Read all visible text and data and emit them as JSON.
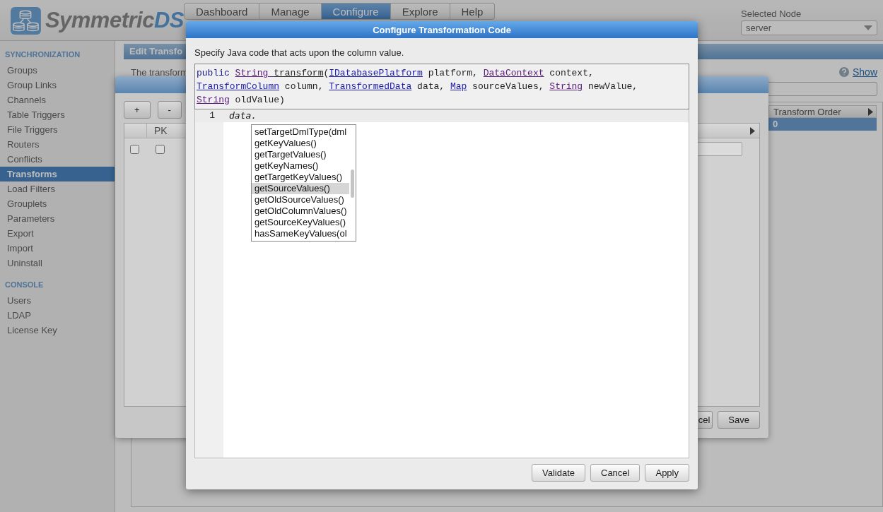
{
  "logo": {
    "name": "Symmetric",
    "suffix": "DS"
  },
  "nav_tabs": [
    {
      "label": "Dashboard",
      "selected": false
    },
    {
      "label": "Manage",
      "selected": false
    },
    {
      "label": "Configure",
      "selected": true
    },
    {
      "label": "Explore",
      "selected": false
    },
    {
      "label": "Help",
      "selected": false
    }
  ],
  "node_selector": {
    "label": "Selected Node",
    "value": "server"
  },
  "sidebar": {
    "sections": [
      {
        "heading": "SYNCHRONIZATION",
        "items": [
          {
            "label": "Groups",
            "selected": false
          },
          {
            "label": "Group Links",
            "selected": false
          },
          {
            "label": "Channels",
            "selected": false
          },
          {
            "label": "Table Triggers",
            "selected": false
          },
          {
            "label": "File Triggers",
            "selected": false
          },
          {
            "label": "Routers",
            "selected": false
          },
          {
            "label": "Conflicts",
            "selected": false
          },
          {
            "label": "Transforms",
            "selected": true
          },
          {
            "label": "Load Filters",
            "selected": false
          },
          {
            "label": "Grouplets",
            "selected": false
          },
          {
            "label": "Parameters",
            "selected": false
          },
          {
            "label": "Export",
            "selected": false
          },
          {
            "label": "Import",
            "selected": false
          },
          {
            "label": "Uninstall",
            "selected": false
          }
        ]
      },
      {
        "heading": "CONSOLE",
        "items": [
          {
            "label": "Users",
            "selected": false
          },
          {
            "label": "LDAP",
            "selected": false
          },
          {
            "label": "License Key",
            "selected": false
          }
        ]
      }
    ]
  },
  "panel": {
    "title": "Edit Transfo",
    "description": "The transform",
    "help_link": "Show",
    "table": {
      "columns": [
        "Transform Order"
      ],
      "rows": [
        {
          "cells": [
            "0"
          ],
          "selected": true
        }
      ]
    }
  },
  "edit_dialog": {
    "toolbar": [
      "+",
      "-"
    ],
    "columns": [
      "PK"
    ],
    "rows": [
      {
        "checked": false,
        "pk": false
      }
    ],
    "buttons": [
      "cel",
      "Save"
    ]
  },
  "code_dialog": {
    "title": "Configure Transformation Code",
    "instruction": "Specify Java code that acts upon the column value.",
    "signature": [
      [
        {
          "text": "public ",
          "kind": "keyword"
        },
        {
          "text": "String ",
          "kind": "link",
          "visited": true
        },
        {
          "text": "transform",
          "kind": "method"
        },
        {
          "text": "(",
          "kind": "plain"
        },
        {
          "text": "IDatabasePlatform",
          "kind": "link",
          "visited": false
        },
        {
          "text": " platform, ",
          "kind": "plain"
        },
        {
          "text": "DataContext",
          "kind": "link",
          "visited": true
        },
        {
          "text": " context,",
          "kind": "plain"
        }
      ],
      [
        {
          "text": "TransformColumn",
          "kind": "link",
          "visited": false
        },
        {
          "text": " column, ",
          "kind": "plain"
        },
        {
          "text": "TransformedData",
          "kind": "link",
          "visited": false
        },
        {
          "text": " data, ",
          "kind": "plain"
        },
        {
          "text": "Map",
          "kind": "link",
          "visited": false
        },
        {
          "text": " sourceValues, ",
          "kind": "plain"
        },
        {
          "text": "String",
          "kind": "link",
          "visited": true
        },
        {
          "text": " newValue,",
          "kind": "plain"
        }
      ],
      [
        {
          "text": "String",
          "kind": "link",
          "visited": true
        },
        {
          "text": " oldValue)",
          "kind": "plain"
        }
      ]
    ],
    "editor": {
      "lines": [
        {
          "number": "1",
          "text": "data.",
          "active": true
        }
      ]
    },
    "autocomplete": {
      "items": [
        {
          "label": "setTargetDmlType(dml",
          "selected": false
        },
        {
          "label": "getKeyValues()",
          "selected": false
        },
        {
          "label": "getTargetValues()",
          "selected": false
        },
        {
          "label": "getKeyNames()",
          "selected": false
        },
        {
          "label": "getTargetKeyValues()",
          "selected": false
        },
        {
          "label": "getSourceValues()",
          "selected": true
        },
        {
          "label": "getOldSourceValues()",
          "selected": false
        },
        {
          "label": "getOldColumnValues()",
          "selected": false
        },
        {
          "label": "getSourceKeyValues()",
          "selected": false
        },
        {
          "label": "hasSameKeyValues(ol",
          "selected": false
        }
      ]
    },
    "buttons": [
      "Validate",
      "Cancel",
      "Apply"
    ]
  }
}
